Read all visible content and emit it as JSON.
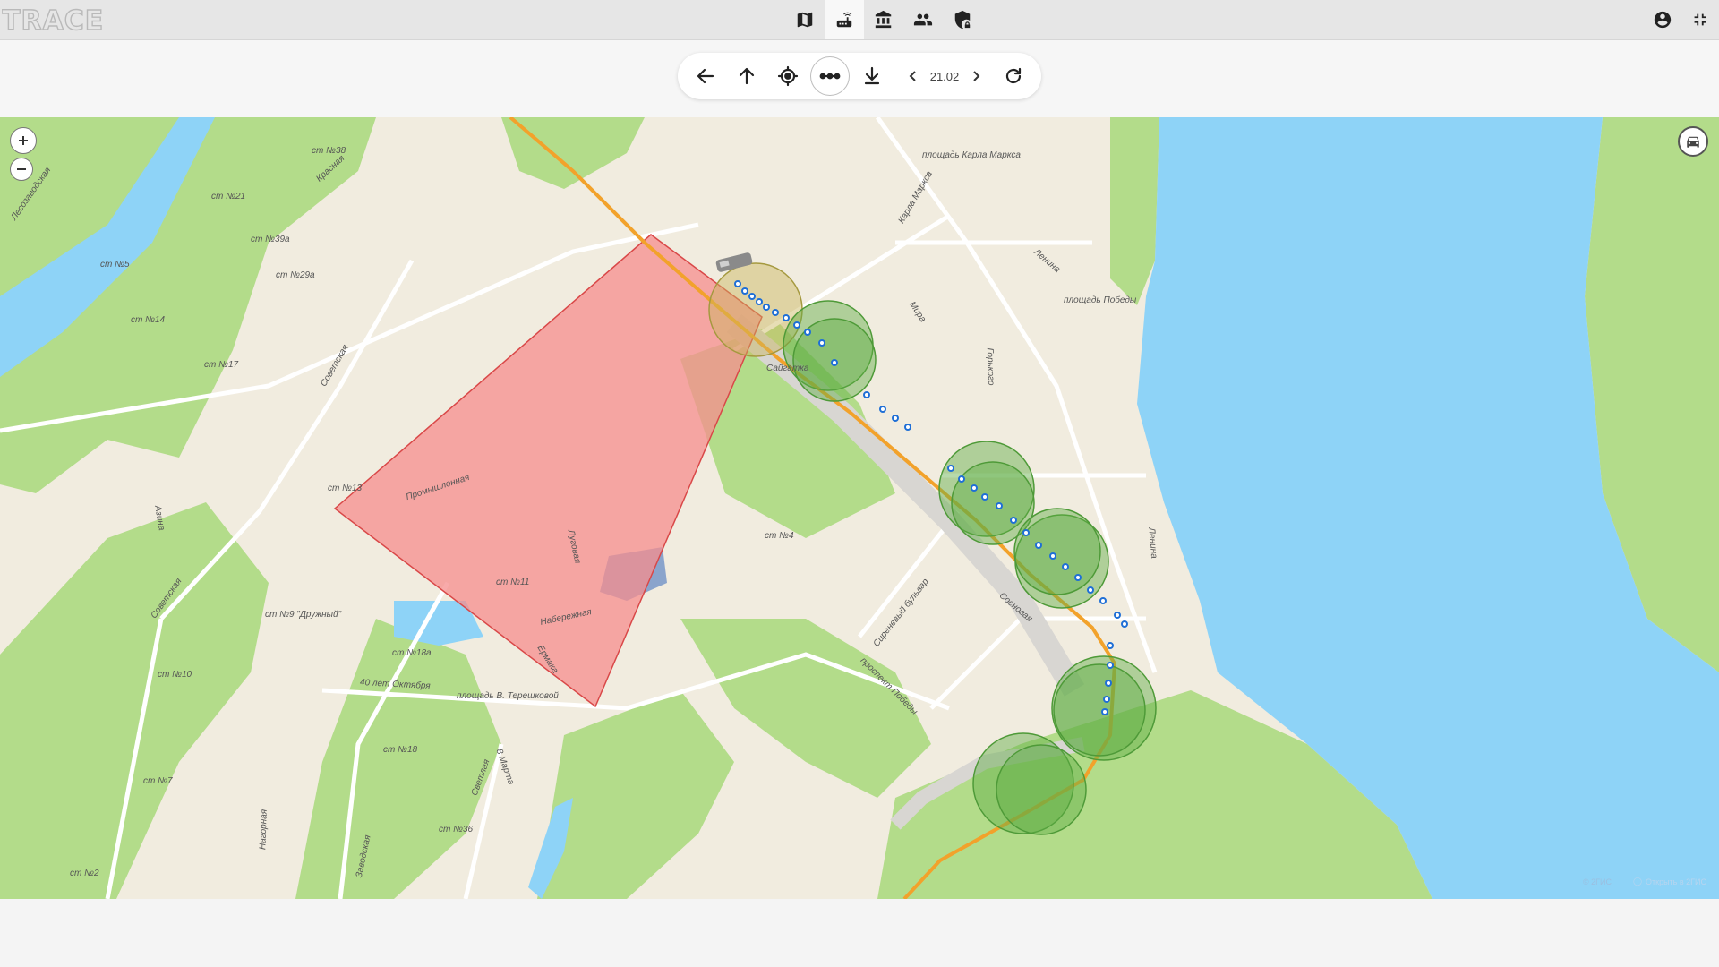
{
  "app": {
    "logo_text": "TRACE"
  },
  "nav": {
    "tabs": [
      {
        "icon": "map-icon",
        "active": false
      },
      {
        "icon": "router-icon",
        "active": true
      },
      {
        "icon": "bank-icon",
        "active": false
      },
      {
        "icon": "people-icon",
        "active": false
      },
      {
        "icon": "shield-lock-icon",
        "active": false
      }
    ],
    "right": [
      {
        "icon": "account-circle-icon"
      },
      {
        "icon": "fullscreen-exit-icon"
      }
    ]
  },
  "toolbar": {
    "buttons": [
      "arrow-back-icon",
      "arrow-up-icon",
      "my-location-icon",
      "route-dots-icon",
      "download-icon",
      "refresh-icon"
    ],
    "selected": "route-dots-icon",
    "date": "21.02"
  },
  "map": {
    "labels": {
      "karl_marx_square": "площадь Карла Маркса",
      "victory_square": "площадь Победы",
      "tereshkova_square": "площадь В. Терешковой",
      "promyshlennaya": "Промышленная",
      "lugovaya": "Луговая",
      "naberezhnaya": "Набережная",
      "ermaka": "Ермака",
      "sovetskaya": "Советская",
      "sovetskaya2": "Советская",
      "oktyabrya": "40 лет Октября",
      "karla_marksa": "Карла Маркса",
      "mira": "Мира",
      "lenina": "Ленина",
      "lenina2": "Ленина",
      "gorkogo": "Горького",
      "sosnovaya": "Сосновая",
      "sirenevy": "Сиреневый бульвар",
      "pobedy_prospekt": "проспект Победы",
      "saygatka": "Сайгатка",
      "krasnaya": "Красная",
      "lesozavodskaya": "Лесозаводская",
      "azina": "Азина",
      "svetlaya": "Светлая",
      "marta8": "8 Марта",
      "nagornaya": "Нагорная",
      "zavodskaya": "Заводская",
      "st38": "ст №38",
      "st21": "ст №21",
      "st39a": "ст №39а",
      "st5": "ст №5",
      "st29a": "ст №29а",
      "st14": "ст №14",
      "st17": "ст №17",
      "st13": "ст №13",
      "st11": "ст №11",
      "st9": "ст №9 \"Дружный\"",
      "st18a": "ст №18а",
      "st10": "ст №10",
      "st18": "ст №18",
      "st7": "ст №7",
      "st36": "ст №36",
      "st2": "ст №2",
      "st4": "ст №4"
    },
    "attribution": "© 2ГИС",
    "open_link": "Открыть в 2ГИС",
    "colors": {
      "water": "#8ed3f7",
      "forest": "#a8d77e",
      "land": "#f1ecdf",
      "zone_fill": "#f58d8d",
      "zone_stroke": "#d94848",
      "route": "#f2a22b",
      "track_point": "#1f6fd6",
      "geofence": "#5fae45"
    }
  }
}
